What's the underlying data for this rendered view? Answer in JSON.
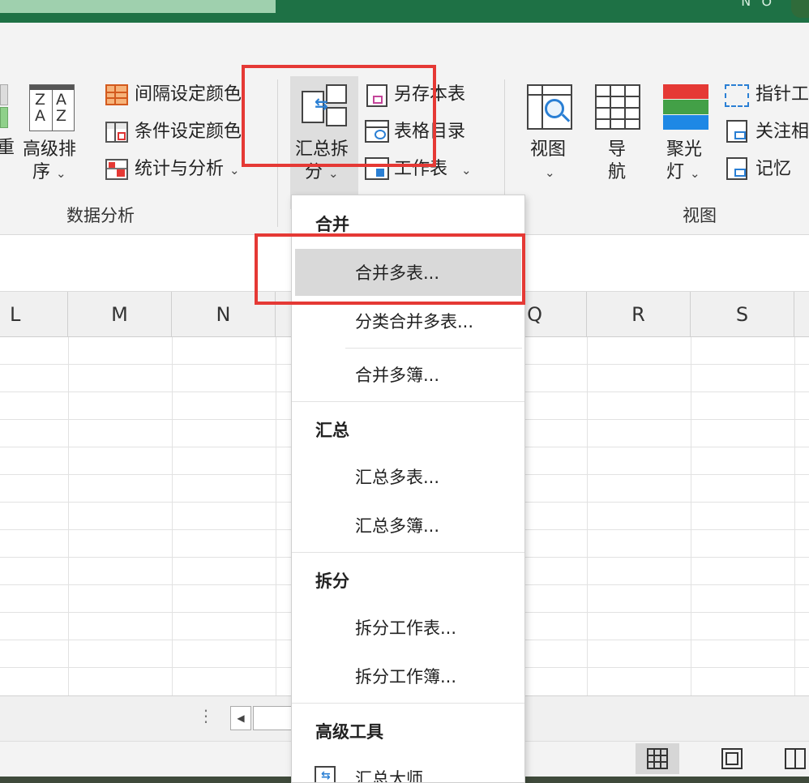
{
  "ribbon": {
    "partial_button": "重",
    "sort": {
      "line1": "高级排",
      "line2": "序"
    },
    "interval_color": "间隔设定颜色",
    "condition_color": "条件设定颜色",
    "stats_analysis": "统计与分析",
    "data_analysis_group": "数据分析",
    "summarize_split": {
      "line1": "汇总拆",
      "line2": "分"
    },
    "save_sheet_as": "另存本表",
    "table_toc": "表格目录",
    "worksheet": "工作表",
    "view": {
      "label": "视图"
    },
    "navigation": {
      "line1": "导",
      "line2": "航"
    },
    "spotlight": {
      "line1": "聚光",
      "line2": "灯"
    },
    "pointer_tool": "指针工",
    "focus": "关注相",
    "memory": "记忆",
    "view_group": "视图"
  },
  "columns": [
    "L",
    "M",
    "N",
    "Q",
    "R",
    "S"
  ],
  "dropdown": {
    "sections": [
      {
        "header": "合并",
        "items": [
          "合并多表...",
          "分类合并多表...",
          "合并多簿..."
        ]
      },
      {
        "header": "汇总",
        "items": [
          "汇总多表...",
          "汇总多簿..."
        ]
      },
      {
        "header": "拆分",
        "items": [
          "拆分工作表...",
          "拆分工作簿..."
        ]
      },
      {
        "header": "高级工具",
        "items": [
          "汇总大师..."
        ]
      }
    ],
    "highlighted_item": "合并多表..."
  },
  "sheet_nav": {
    "more": "⋮",
    "prev": "◀"
  },
  "titlebar": {
    "corner_text": "N⁻ ℧"
  },
  "colors": {
    "brand_green": "#1e7145",
    "highlight_red": "#e53935",
    "hover_gray": "#d9d9d9"
  }
}
